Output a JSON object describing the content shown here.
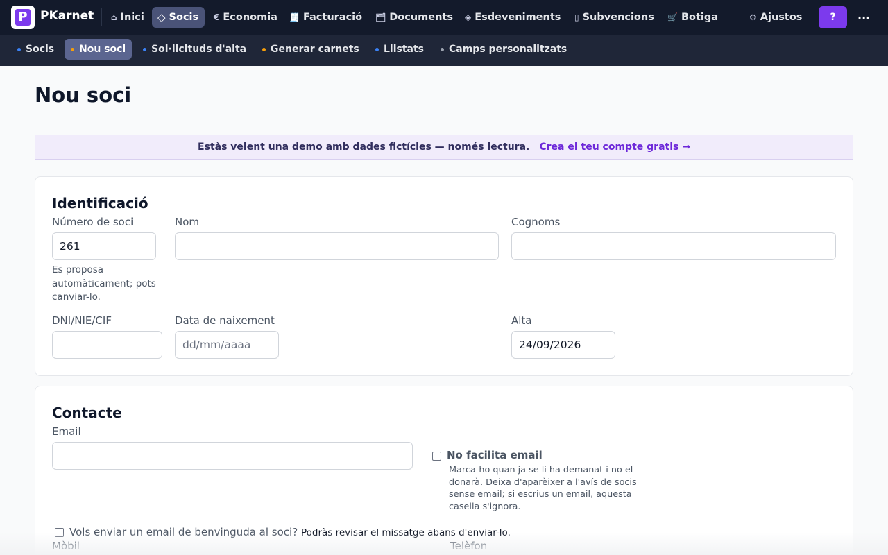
{
  "app": {
    "brand": "PKarnet",
    "logo_letter": "P"
  },
  "topnav": {
    "items": [
      {
        "label": "Inici",
        "icon": "⌂"
      },
      {
        "label": "Socis",
        "icon": "◇"
      },
      {
        "label": "Economia",
        "icon": "€"
      },
      {
        "label": "Facturació",
        "icon": "🧾"
      },
      {
        "label": "Documents",
        "icon": "🗂"
      },
      {
        "label": "Esdeveniments",
        "icon": "◈"
      },
      {
        "label": "Subvencions",
        "icon": "▯"
      },
      {
        "label": "Botiga",
        "icon": "🛒"
      },
      {
        "label": "Ajustos",
        "icon": "⚙"
      }
    ],
    "help_label": "?",
    "more_label": "..."
  },
  "subnav": {
    "items": [
      {
        "label": "Socis",
        "dot": "#3b82f6"
      },
      {
        "label": "Nou soci",
        "dot": "#f59e0b"
      },
      {
        "label": "Sol·licituds d'alta",
        "dot": "#3b82f6"
      },
      {
        "label": "Generar carnets",
        "dot": "#f59e0b"
      },
      {
        "label": "Llistats",
        "dot": "#3b82f6"
      },
      {
        "label": "Camps personalitzats",
        "dot": "#9ca3af"
      }
    ]
  },
  "page": {
    "title": "Nou soci"
  },
  "banner": {
    "text": "Estàs veient una demo amb dades fictícies — només lectura.",
    "link": "Crea el teu compte gratis →"
  },
  "identificacio": {
    "title": "Identificació",
    "numero_label": "Número de soci",
    "numero_value": "261",
    "numero_hint": "Es proposa automàticament; pots canviar-lo.",
    "nom_label": "Nom",
    "nom_value": "",
    "cognoms_label": "Cognoms",
    "cognoms_value": "",
    "dni_label": "DNI/NIE/CIF",
    "dni_value": "",
    "naixement_label": "Data de naixement",
    "naixement_placeholder": "dd/mm/aaaa",
    "alta_label": "Alta",
    "alta_value": "24/09/2026"
  },
  "contacte": {
    "title": "Contacte",
    "email_label": "Email",
    "email_value": "",
    "no_email_label": "No facilita email",
    "no_email_checked": false,
    "no_email_hint": "Marca-ho quan ja se li ha demanat i no el donarà. Deixa d'aparèixer a l'avís de socis sense email; si escrius un email, aquesta casella s'ignora.",
    "welcome_question": "Vols enviar un email de benvinguda al soci?",
    "welcome_note": "Podràs revisar el missatge abans d'enviar-lo.",
    "welcome_checked": false,
    "mobil_label": "Mòbil",
    "telefon_label": "Telèfon"
  },
  "colors": {
    "accent": "#7c3aed",
    "topbar": "#131a2b",
    "subbar": "#1f2638"
  }
}
